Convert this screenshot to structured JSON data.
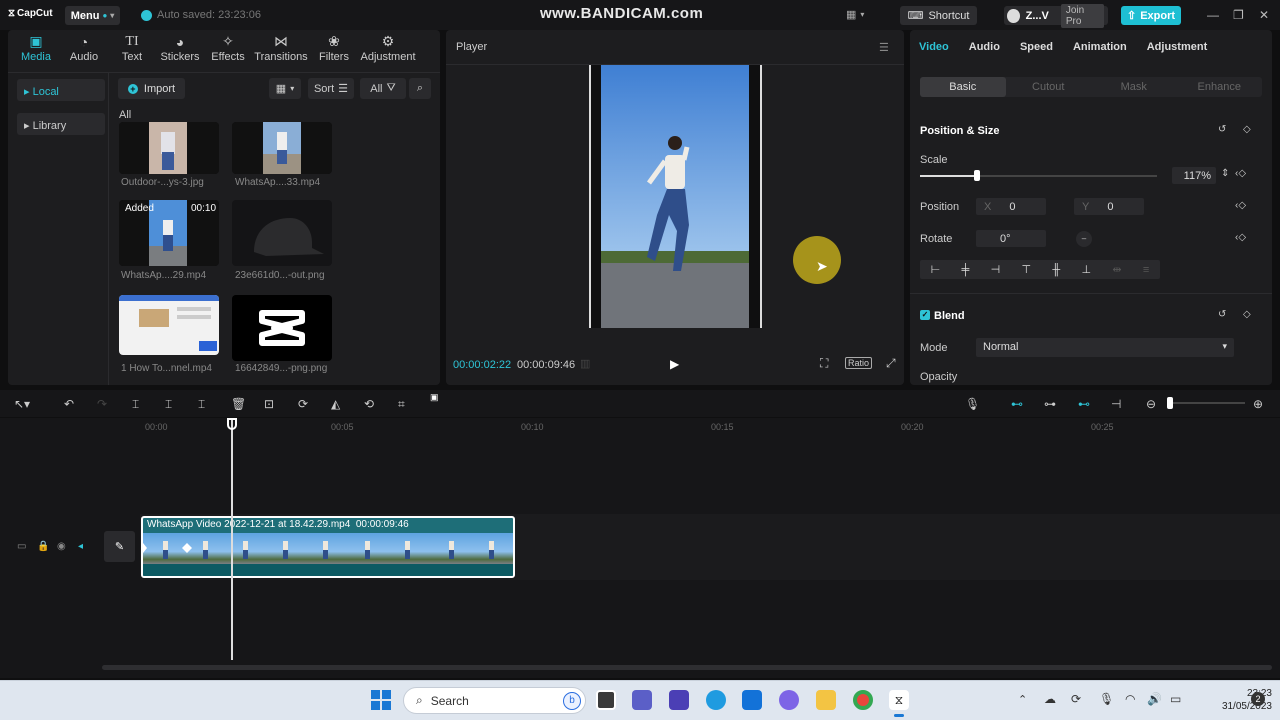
{
  "titlebar": {
    "app_name": "CapCut",
    "menu_label": "Menu",
    "autosave": "Auto saved: 23:23:06",
    "watermark": "www.BANDICAM.com",
    "shortcut_label": "Shortcut",
    "account_name": "Z...V",
    "join_pro": "Join Pro",
    "export_label": "Export"
  },
  "media_tabs": [
    {
      "label": "Media",
      "icon": "media-icon",
      "active": true
    },
    {
      "label": "Audio",
      "icon": "audio-icon"
    },
    {
      "label": "Text",
      "icon": "text-icon"
    },
    {
      "label": "Stickers",
      "icon": "stickers-icon"
    },
    {
      "label": "Effects",
      "icon": "effects-icon"
    },
    {
      "label": "Transitions",
      "icon": "transitions-icon"
    },
    {
      "label": "Filters",
      "icon": "filters-icon"
    },
    {
      "label": "Adjustment",
      "icon": "adjustment-icon"
    }
  ],
  "media_sidebar": {
    "local": "Local",
    "library": "Library"
  },
  "media_toolbar": {
    "import": "Import",
    "sort": "Sort",
    "filter_all": "All",
    "all_label": "All"
  },
  "media_items": [
    {
      "caption": "Outdoor-...ys-3.jpg"
    },
    {
      "caption": "WhatsAp....33.mp4"
    },
    {
      "caption": "WhatsAp....29.mp4",
      "badge": "Added",
      "duration": "00:10"
    },
    {
      "caption": "23e661d0...-out.png"
    },
    {
      "caption": "1 How To...nnel.mp4"
    },
    {
      "caption": "16642849...-png.png"
    }
  ],
  "player": {
    "title": "Player",
    "current_time": "00:00:02:22",
    "duration": "00:00:09:46",
    "ratio_label": "Ratio"
  },
  "props": {
    "tabs": [
      "Video",
      "Audio",
      "Speed",
      "Animation",
      "Adjustment"
    ],
    "subtabs": [
      "Basic",
      "Cutout",
      "Mask",
      "Enhance"
    ],
    "position_size_title": "Position & Size",
    "scale_label": "Scale",
    "scale_value": "117%",
    "scale_level": 0.25,
    "position_label": "Position",
    "x_label": "X",
    "x_value": "0",
    "y_label": "Y",
    "y_value": "0",
    "rotate_label": "Rotate",
    "rotate_value": "0°",
    "blend_title": "Blend",
    "mode_label": "Mode",
    "mode_value": "Normal",
    "opacity_label": "Opacity"
  },
  "timeline": {
    "ruler": [
      "00:00",
      "00:05",
      "00:10",
      "00:15",
      "00:20",
      "00:25"
    ],
    "clip_label": "WhatsApp Video 2022-12-21 at 18.42.29.mp4",
    "clip_duration": "00:00:09:46"
  },
  "taskbar": {
    "search_placeholder": "Search",
    "time": "23:23",
    "date": "31/05/2023",
    "notification_count": "2"
  }
}
